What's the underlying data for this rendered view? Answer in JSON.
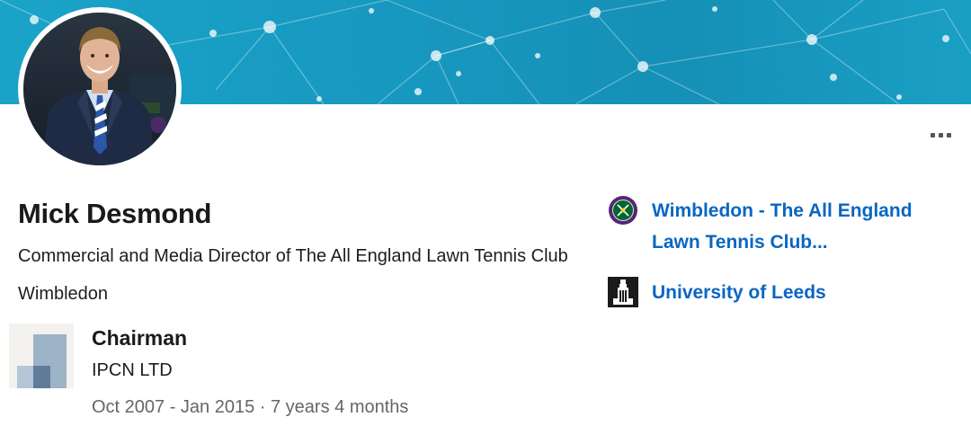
{
  "profile": {
    "name": "Mick Desmond",
    "headline": "Commercial and Media Director of The All England Lawn Tennis Club Wimbledon"
  },
  "organizations": [
    {
      "name": "Wimbledon - The All England Lawn Tennis Club...",
      "logo_icon": "wimbledon-crest-icon"
    },
    {
      "name": "University of Leeds",
      "logo_icon": "university-of-leeds-icon"
    }
  ],
  "experience": {
    "title": "Chairman",
    "company": "IPCN LTD",
    "dates": "Oct 2007 - Jan 2015 · 7 years 4 months",
    "logo_icon": "company-placeholder-icon"
  },
  "actions": {
    "more_icon": "more-options-icon"
  },
  "colors": {
    "banner": "#1797bf",
    "link": "#0a66c2",
    "secondary_text": "#666666",
    "wimbledon_purple": "#54267a",
    "wimbledon_green": "#006633"
  }
}
